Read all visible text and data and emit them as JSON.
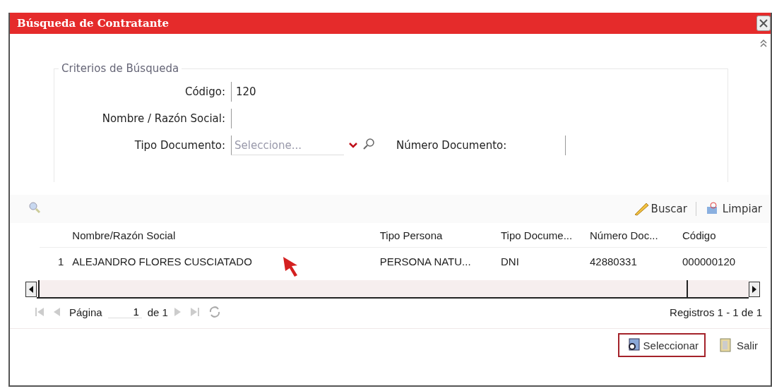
{
  "window": {
    "title": "Búsqueda de Contratante"
  },
  "criteria": {
    "legend": "Criterios de Búsqueda",
    "fields": [
      {
        "kind": "text",
        "label": "Código:",
        "value": "120"
      },
      {
        "kind": "text",
        "label": "Nombre / Razón Social:"
      },
      {
        "kind": "select",
        "label": "Tipo Documento:",
        "placeholder": "Seleccione..."
      },
      {
        "kind": "text",
        "label": "Número Documento:"
      }
    ]
  },
  "toolbar": [
    "Buscar",
    "Limpiar"
  ],
  "table": {
    "columns": [
      "Nombre/Razón Social",
      "Tipo Persona",
      "Tipo Docume...",
      "Número Doc...",
      "Código"
    ],
    "rows": [
      {
        "number": "1",
        "cells": [
          "ALEJANDRO FLORES CUSCIATADO",
          "PERSONA NATU...",
          "DNI",
          "42880331",
          "000000120"
        ]
      }
    ]
  },
  "pager": {
    "page_label": "Página",
    "page": "1",
    "of": "de 1",
    "records": "Registros 1 - 1 de 1"
  },
  "buttons": [
    {
      "label": "Seleccionar",
      "focused": true
    },
    {
      "label": "Salir",
      "focused": false
    }
  ]
}
